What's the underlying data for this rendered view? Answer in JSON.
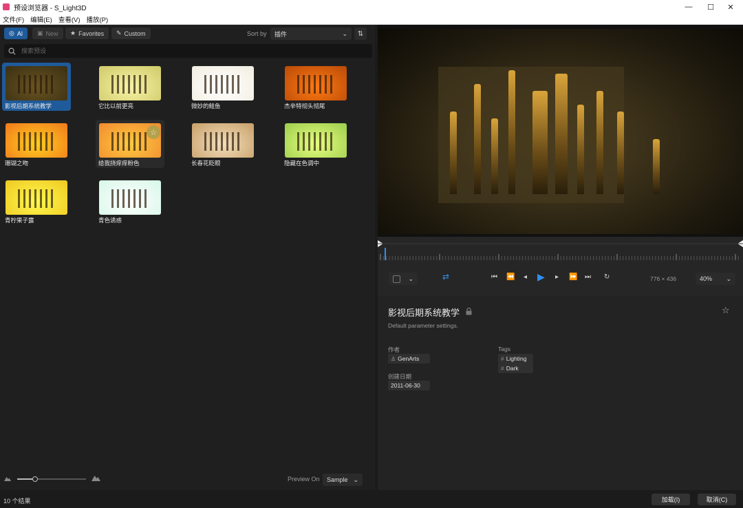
{
  "window": {
    "title": "预设浏览器 - S_Light3D",
    "minimize": "—",
    "maximize": "☐",
    "close": "✕"
  },
  "menu": [
    "文件(F)",
    "编辑(E)",
    "查看(V)",
    "播放(P)"
  ],
  "filters": {
    "all": "Al",
    "new": "New",
    "favorites": "Favorites",
    "custom": "Custom"
  },
  "sort": {
    "label": "Sort by",
    "value": "插件",
    "toggle_icon": "⇅"
  },
  "search": {
    "placeholder": "搜索预设"
  },
  "presets": [
    {
      "label": "影视后期系统教学",
      "colors": [
        "#6a5420",
        "#3a2f14"
      ],
      "state": "selected"
    },
    {
      "label": "它比以前更亮",
      "colors": [
        "#f7f4a8",
        "#cfc968"
      ],
      "state": ""
    },
    {
      "label": "微妙的鲑鱼",
      "colors": [
        "#ffffff",
        "#f1ede0"
      ],
      "state": ""
    },
    {
      "label": "杰辛特彻头彻尾",
      "colors": [
        "#ff7a12",
        "#b84a08"
      ],
      "state": ""
    },
    {
      "label": "珊瑚之吻",
      "colors": [
        "#ffd020",
        "#f0781c"
      ],
      "state": ""
    },
    {
      "label": "给我挠痒痒粉色",
      "colors": [
        "#ffcc40",
        "#f08a30"
      ],
      "state": "hover"
    },
    {
      "label": "长春花眨眼",
      "colors": [
        "#f3dfbd",
        "#c69e68"
      ],
      "state": ""
    },
    {
      "label": "隐藏在色调中",
      "colors": [
        "#e8ff80",
        "#9ccc4c"
      ],
      "state": ""
    },
    {
      "label": "青柠果子露",
      "colors": [
        "#fffa50",
        "#eec820"
      ],
      "state": ""
    },
    {
      "label": "青色诱惑",
      "colors": [
        "#ffffff",
        "#d6f7e8"
      ],
      "state": ""
    }
  ],
  "footer": {
    "preview_on_label": "Preview On",
    "preview_on_value": "Sample",
    "result_count": "10 个结果"
  },
  "player": {
    "resolution": "776 × 436",
    "zoom": "40%"
  },
  "details": {
    "title": "影视后期系统教学",
    "description": "Default parameter settings.",
    "author_label": "作者",
    "author": "GenArts",
    "date_label": "创建日期",
    "date": "2011-06-30",
    "tags_label": "Tags",
    "tags": [
      "Lighting",
      "Dark"
    ]
  },
  "actions": {
    "load": "加载(I)",
    "cancel": "取消(C)"
  },
  "colors": {
    "accent": "#1f5a9a",
    "play": "#2f8ff0"
  }
}
